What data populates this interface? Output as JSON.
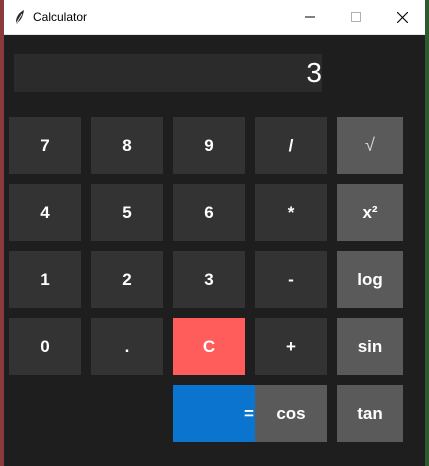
{
  "window": {
    "title": "Calculator",
    "minimize_icon": "minimize-icon",
    "maximize_icon": "maximize-icon",
    "close_icon": "close-icon",
    "app_icon": "feather-icon"
  },
  "display": {
    "value": "3"
  },
  "buttons": {
    "b7": "7",
    "b8": "8",
    "b9": "9",
    "div": "/",
    "sqrt": "√",
    "b4": "4",
    "b5": "5",
    "b6": "6",
    "mul": "*",
    "sq": "x²",
    "b1": "1",
    "b2": "2",
    "b3": "3",
    "sub": "-",
    "log": "log",
    "b0": "0",
    "dot": ".",
    "clear": "C",
    "add": "+",
    "sin": "sin",
    "eq": "=",
    "cos": "cos",
    "tan": "tan"
  },
  "colors": {
    "background": "#1e1e1e",
    "button": "#333333",
    "scientific_button": "#5a5a5a",
    "clear_button": "#ff5c5c",
    "equals_button": "#0a74cf",
    "display": "#2b2b2b"
  }
}
